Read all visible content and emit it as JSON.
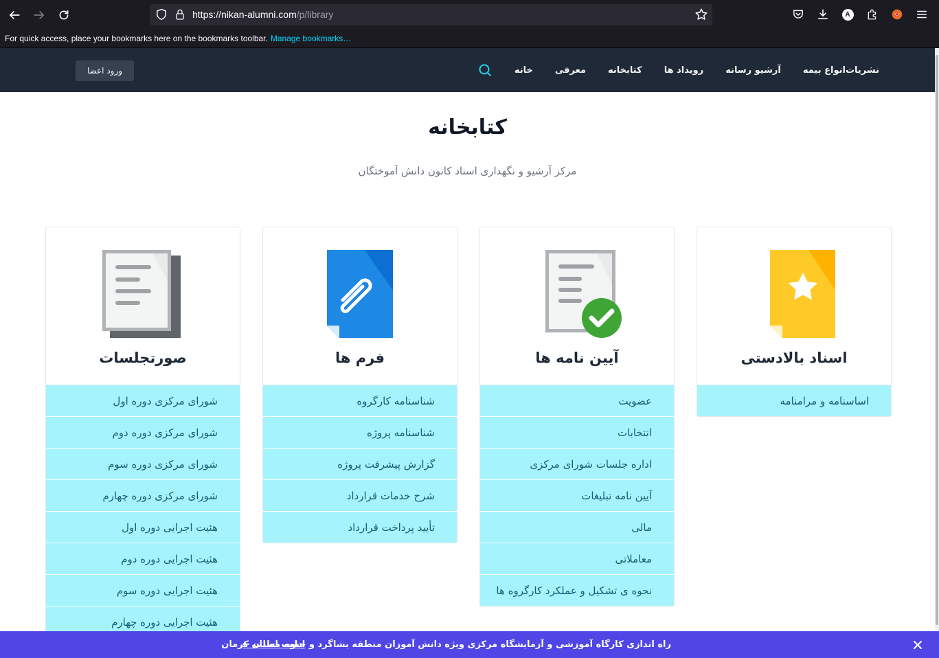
{
  "browser": {
    "url_host": "https://nikan-alumni.com",
    "url_path": "/p/library",
    "profile_initial": "A",
    "bookmarks_message": "For quick access, place your bookmarks here on the bookmarks toolbar.",
    "bookmarks_link": "Manage bookmarks…"
  },
  "header": {
    "login_label": "ورود اعضا",
    "nav": [
      "خانه",
      "معرفی",
      "کتابخانه",
      "رویداد ها",
      "آرشیو رسانه",
      "انواع بیمه",
      "نشریات"
    ]
  },
  "page": {
    "title": "کتابخانه",
    "subtitle": "مرکز آرشیو و نگهداری اسناد کانون دانش آموختگان"
  },
  "cards": [
    {
      "title": "اسناد بالادستی",
      "icon": "star-document-icon",
      "items": [
        "اساسنامه و مرامنامه"
      ]
    },
    {
      "title": "آیین نامه ها",
      "icon": "approved-document-icon",
      "items": [
        "عضویت",
        "انتخابات",
        "اداره جلسات شورای مرکزی",
        "آیین نامه تبلیغات",
        "مالی",
        "معاملاتی",
        "نحوه ی تشکیل و عملکرد کارگروه ها"
      ]
    },
    {
      "title": "فرم ها",
      "icon": "attachment-document-icon",
      "items": [
        "شناسنامه کارگروه",
        "شناسنامه پروژه",
        "گزارش پیشرفت پروژه",
        "شرح خدمات قرارداد",
        "تأیید پرداخت قرارداد"
      ]
    },
    {
      "title": "صورتجلسات",
      "icon": "documents-stack-icon",
      "items": [
        "شورای مرکزی دوره اول",
        "شورای مرکزی دوره دوم",
        "شورای مرکزی دوره سوم",
        "شورای مرکزی دوره چهارم",
        "هئیت اجرایی دوره اول",
        "هئیت اجرایی دوره دوم",
        "هئیت اجرایی دوره سوم",
        "هئیت اجرایی دوره چهارم"
      ]
    }
  ],
  "announcement": {
    "text": "راه اندازی کارگاه آموزشی و آزمایشگاه مرکزی ویژه دانش آموزان منطقه بشاگرد و جنوب استان کرمان",
    "link": "ادامه مطلب ←"
  },
  "colors": {
    "header_bg": "#1f2937",
    "list_item_bg": "#a5f3fc",
    "list_item_text": "#155e75",
    "announcement_bg": "#4f46e5",
    "search_icon": "#22d3ee"
  }
}
